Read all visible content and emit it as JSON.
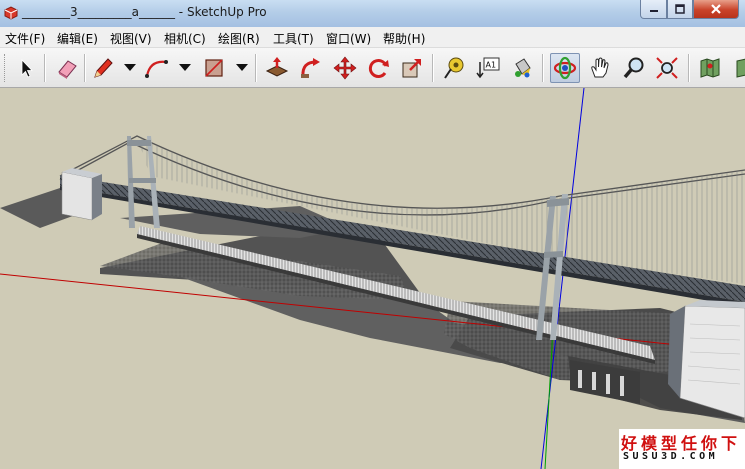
{
  "window": {
    "title": "________3_________a______ - SketchUp Pro"
  },
  "menu": [
    {
      "label": "文件(F)"
    },
    {
      "label": "编辑(E)"
    },
    {
      "label": "视图(V)"
    },
    {
      "label": "相机(C)"
    },
    {
      "label": "绘图(R)"
    },
    {
      "label": "工具(T)"
    },
    {
      "label": "窗口(W)"
    },
    {
      "label": "帮助(H)"
    }
  ],
  "toolbar": {
    "tools": [
      "select-icon",
      "eraser-icon",
      "pencil-icon",
      "arc-icon",
      "rectangle-icon",
      "push-pull-icon",
      "follow-me-icon",
      "move-icon",
      "rotate-icon",
      "scale-icon",
      "tape-measure-icon",
      "text-label-icon",
      "paint-bucket-icon",
      "orbit-icon",
      "pan-icon",
      "zoom-icon",
      "zoom-extents-icon",
      "map-icon"
    ],
    "text_tool_label": "A1",
    "active_tool": "orbit-icon"
  },
  "watermark": {
    "line1": "好模型任你下",
    "line2": "SUSU3D.COM"
  },
  "colors": {
    "viewport_bg": "#cfcbb6",
    "axis_red": "#c00000",
    "axis_green": "#00a000",
    "axis_blue": "#0000e0",
    "watermark_red": "#d01010"
  }
}
